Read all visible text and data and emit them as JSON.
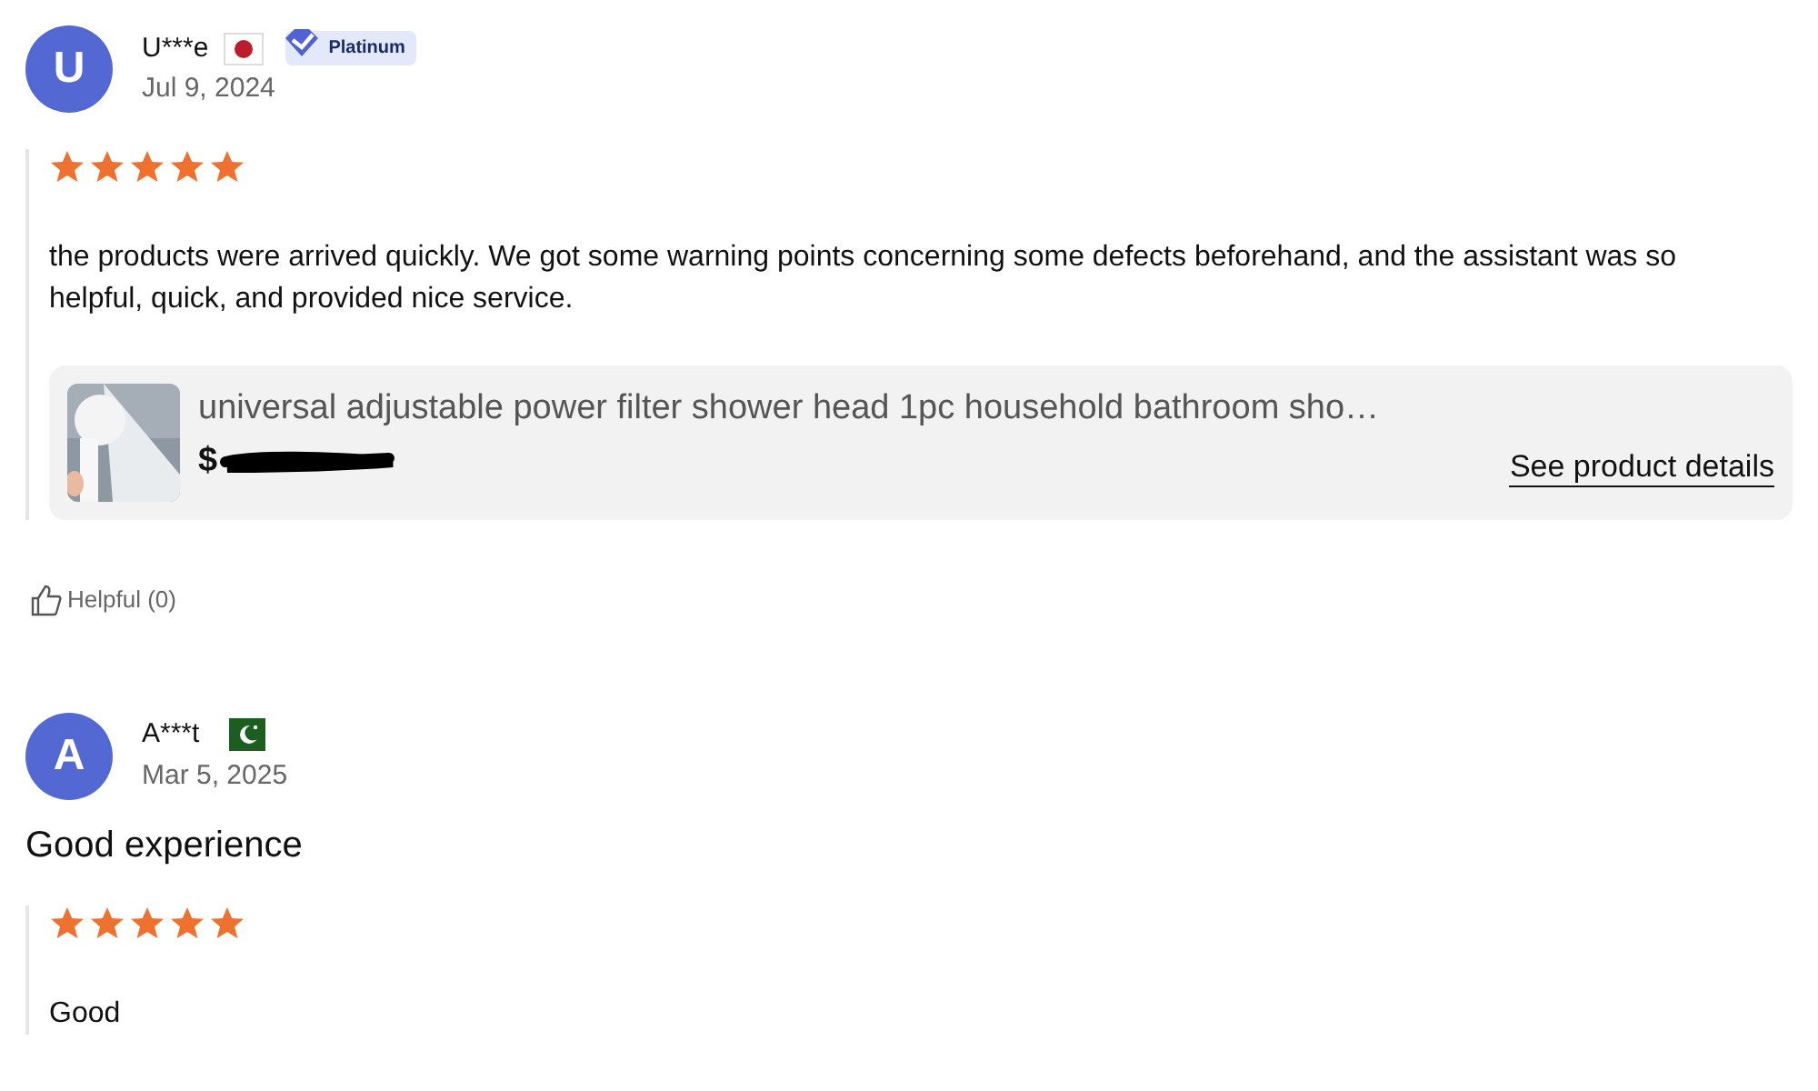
{
  "reviews": [
    {
      "avatar": "U",
      "name": "U***e",
      "flag": {
        "kind": "jp"
      },
      "badge": {
        "label": "Platinum"
      },
      "date": "Jul 9, 2024",
      "stars": 5,
      "text": "the products were arrived quickly. We got some warning points concerning some defects beforehand, and the assistant was so helpful, quick, and provided nice service.",
      "product": {
        "kind": "picture",
        "title": "universal adjustable power filter shower head 1pc household bathroom sho…",
        "price": "$",
        "price_redacted": true,
        "link": "See product details"
      },
      "helpful": "Helpful (0)"
    },
    {
      "avatar": "A",
      "name": "A***t",
      "flag": {
        "kind": "pk"
      },
      "date": "Mar 5, 2025",
      "title": "Good experience",
      "stars": 5,
      "text": "Good"
    }
  ]
}
